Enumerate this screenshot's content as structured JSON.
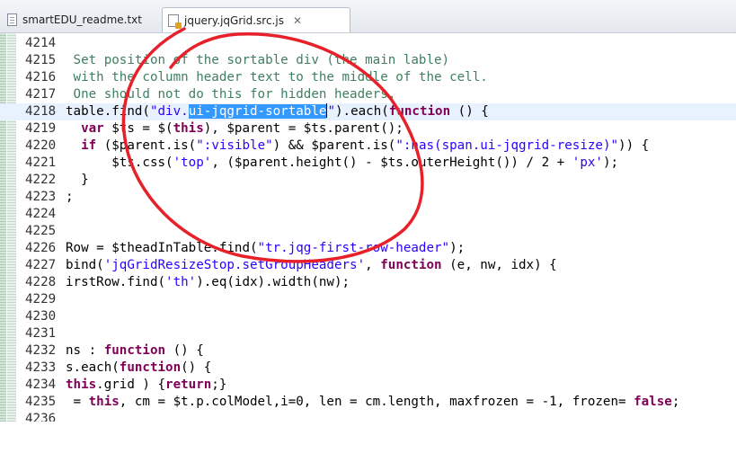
{
  "tabs": [
    {
      "label": "smartEDU_readme.txt",
      "active": false,
      "icon": "text-file-icon"
    },
    {
      "label": "jquery.jqGrid.src.js",
      "active": true,
      "icon": "javascript-file-icon",
      "close": "✕"
    }
  ],
  "editor": {
    "current_line": 4218,
    "selected_text": "ui-jqgrid-sortable",
    "annotation": "red freehand circle around lines 4215-4226",
    "annotation_color": "#e8202a",
    "lines": [
      {
        "no": "4214",
        "text": ""
      },
      {
        "no": "4215",
        "text": " Set position of the sortable div (the main lable)"
      },
      {
        "no": "4216",
        "text": " with the column header text to the middle of the cell."
      },
      {
        "no": "4217",
        "text": " One should not do this for hidden headers."
      },
      {
        "no": "4218",
        "text": "table.find(\"div.ui-jqgrid-sortable\").each(function () {"
      },
      {
        "no": "4219",
        "text": "  var $ts = $(this), $parent = $ts.parent();"
      },
      {
        "no": "4220",
        "text": "  if ($parent.is(\":visible\") && $parent.is(\":has(span.ui-jqgrid-resize)\")) {"
      },
      {
        "no": "4221",
        "text": "      $ts.css('top', ($parent.height() - $ts.outerHeight()) / 2 + 'px');"
      },
      {
        "no": "4222",
        "text": "  }"
      },
      {
        "no": "4223",
        "text": ";"
      },
      {
        "no": "4224",
        "text": ""
      },
      {
        "no": "4225",
        "text": ""
      },
      {
        "no": "4226",
        "text": "Row = $theadInTable.find(\"tr.jqg-first-row-header\");"
      },
      {
        "no": "4227",
        "text": "bind('jqGridResizeStop.setGroupHeaders', function (e, nw, idx) {"
      },
      {
        "no": "4228",
        "text": "irstRow.find('th').eq(idx).width(nw);"
      },
      {
        "no": "4229",
        "text": ""
      },
      {
        "no": "4230",
        "text": ""
      },
      {
        "no": "4231",
        "text": ""
      },
      {
        "no": "4232",
        "text": "ns : function () {"
      },
      {
        "no": "4233",
        "text": "s.each(function() {"
      },
      {
        "no": "4234",
        "text": "this.grid ) {return;}"
      },
      {
        "no": "4235",
        "text": " = this, cm = $t.p.colModel,i=0, len = cm.length, maxfrozen = -1, frozen= false;"
      }
    ]
  }
}
